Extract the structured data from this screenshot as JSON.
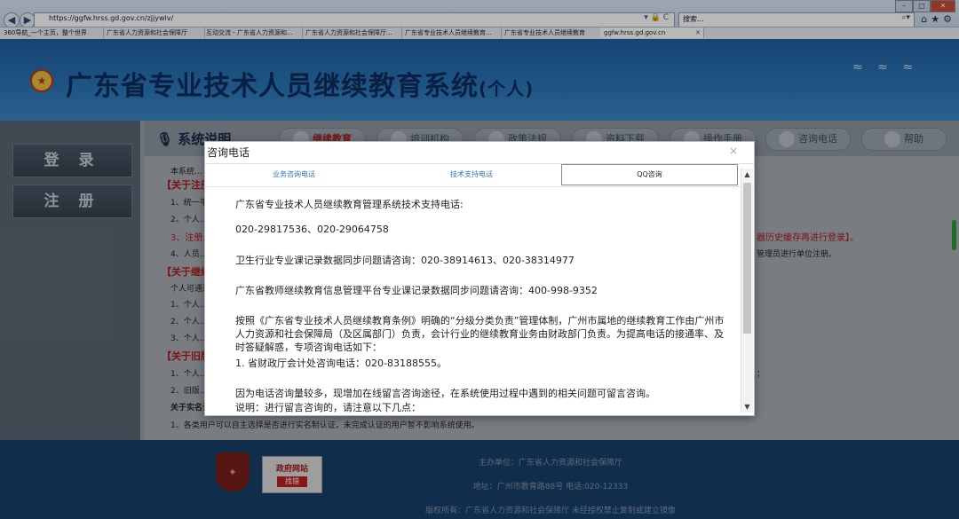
{
  "browser": {
    "url": "https://ggfw.hrss.gd.gov.cn/zjjywlv/",
    "search_label": "搜索...",
    "tabs": [
      {
        "label": "360导航_一个主页，整个世界"
      },
      {
        "label": "广东省人力资源和社会保障厅"
      },
      {
        "label": "互动交流 - 广东省人力资源和..."
      },
      {
        "label": "广东省人力资源和社会保障厅..."
      },
      {
        "label": "广东省专业技术人员继续教育..."
      },
      {
        "label": "广东省专业技术人员继续教育"
      },
      {
        "label": "ggfw.hrss.gd.gov.cn"
      }
    ]
  },
  "site": {
    "title": "广东省专业技术人员继续教育系统",
    "title_suffix": "(个人)",
    "login": "登 录",
    "register": "注 册",
    "sys_title": "系统说明",
    "topnav": [
      "继续教育",
      "培训机构",
      "政策法规",
      "资料下载",
      "操作手册",
      "咨询电话",
      "帮助"
    ]
  },
  "background_text": {
    "lines": [
      "本系统...",
      "【关于注册】",
      "1、统一平...",
      "2、个人...",
      "3、注册...",
      "4、人员...",
      "【关于继续教育】",
      "个人可通过...",
      "1、个人...",
      "2、个人...",
      "3、个人...",
      "【关于旧版】",
      "1、个人...",
      "2、旧版...",
      "关于实名认证...",
      "1、各类用户可以自主选择是否进行实名制认证，未完成认证的用户暂不影响系统使用。"
    ],
    "right_fragments": {
      "r1": "器历史缓存再进行登录】。",
      "r2": "管理员进行单位注册。",
      "r3": "；"
    }
  },
  "footer": {
    "sponsor": "主办单位：广东省人力资源和社会保障厅",
    "address": "地址：广州市教育路88号 电话:020-12333",
    "copyright": "版权所有：广东省人力资源和社会保障厅 未经授权禁止复制或建立镜像",
    "badge2_top": "政府网站",
    "badge2_bottom": "找错"
  },
  "modal": {
    "title": "咨询电话",
    "close": "×",
    "tabs": [
      {
        "label": "业务咨询电话"
      },
      {
        "label": "技术支持电话"
      },
      {
        "label": "QQ咨询"
      }
    ],
    "active_tab": 2,
    "paragraphs": [
      "广东省专业技术人员继续教育管理系统技术支持电话:",
      "020-29817536、020-29064758",
      "卫生行业专业课记录数据同步问题请咨询：020-38914613、020-38314977",
      "广东省教师继续教育信息管理平台专业课记录数据同步问题请咨询：400-998-9352",
      "按照《广东省专业技术人员继续教育条例》明确的“分级分类负责”管理体制，广州市属地的继续教育工作由广州市人力资源和社会保障局（及区属部门）负责，会计行业的继续教育业务由财政部门负责。为提高电话的接通率、及时答疑解惑，专项咨询电话如下：",
      "1. 省财政厅会计处咨询电话：020-83188555。",
      "因为电话咨询量较多，现增加在线留言咨询途径，在系统使用过程中遇到的相关问题可留言咨询。",
      "说明：进行留言咨询的，请注意以下几点："
    ]
  }
}
